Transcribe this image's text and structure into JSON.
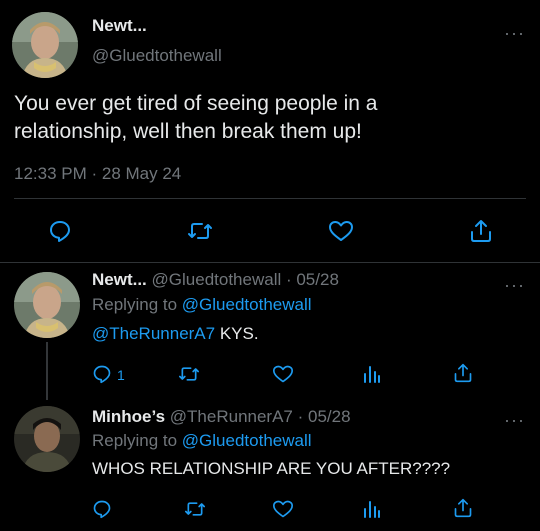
{
  "main_tweet": {
    "display_name": "Newt...",
    "handle": "@Gluedtothewall",
    "text_line1": "You ever get tired of seeing people in a",
    "text_line2": "relationship, well then break them up!",
    "timestamp": "12:33 PM · 28 May 24",
    "more_label": "···"
  },
  "reply1": {
    "display_name": "Newt...",
    "handle_date": "@Gluedtothewall · 05/28",
    "replying_prefix": "Replying to",
    "replying_handle": "@Gluedtothewall",
    "mention": "@TheRunnerA7",
    "body_text": "KYS.",
    "reply_count": "1",
    "more_label": "···"
  },
  "reply2": {
    "display_name": "Minhoe’s",
    "handle_date": "@TheRunnerA7 · 05/28",
    "replying_prefix": "Replying to",
    "replying_handle": "@Gluedtothewall",
    "body_text": "WHOS RELATIONSHIP ARE YOU AFTER????",
    "more_label": "···"
  },
  "colors": {
    "background": "#000000",
    "text": "#e7e9ea",
    "secondary": "#71767b",
    "link": "#1d9bf0",
    "divider": "#2f3336"
  },
  "icons": [
    "reply-icon",
    "retweet-icon",
    "like-icon",
    "share-icon",
    "analytics-icon",
    "more-icon"
  ]
}
